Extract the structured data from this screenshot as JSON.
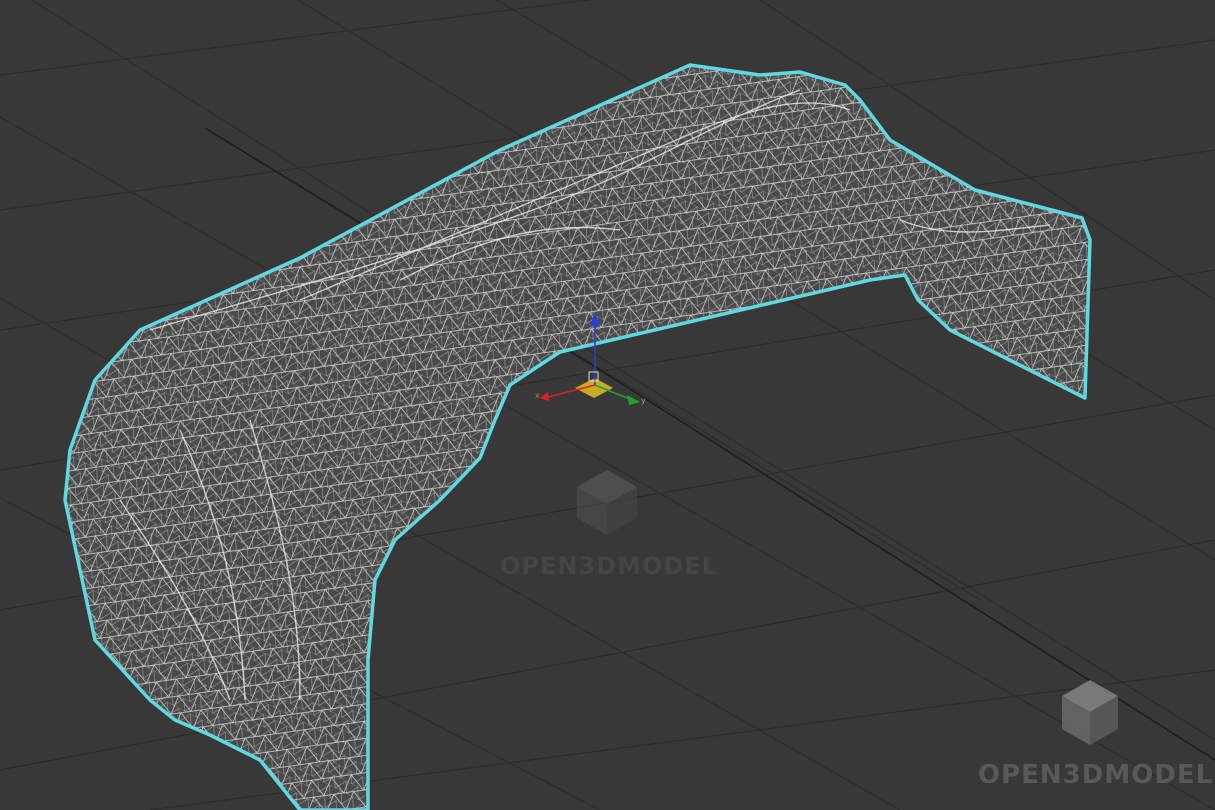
{
  "viewport": {
    "background": "#383838",
    "grid_color": "#2b2b2b",
    "mesh_wire_color": "#e8e8e8",
    "mesh_fill_color": "#4a4a4a",
    "selection_outline_color": "#5fd8e0"
  },
  "gizmo": {
    "x_label": "x",
    "y_label": "y",
    "x_color": "#e02020",
    "y_color": "#20a030",
    "z_color": "#2040e0",
    "plane_color": "#e0c020"
  },
  "watermark": {
    "center_text": "OPEN3DMODEL",
    "corner_text": "OPEN3DMODEL",
    "icon": "cube-logo-icon"
  }
}
